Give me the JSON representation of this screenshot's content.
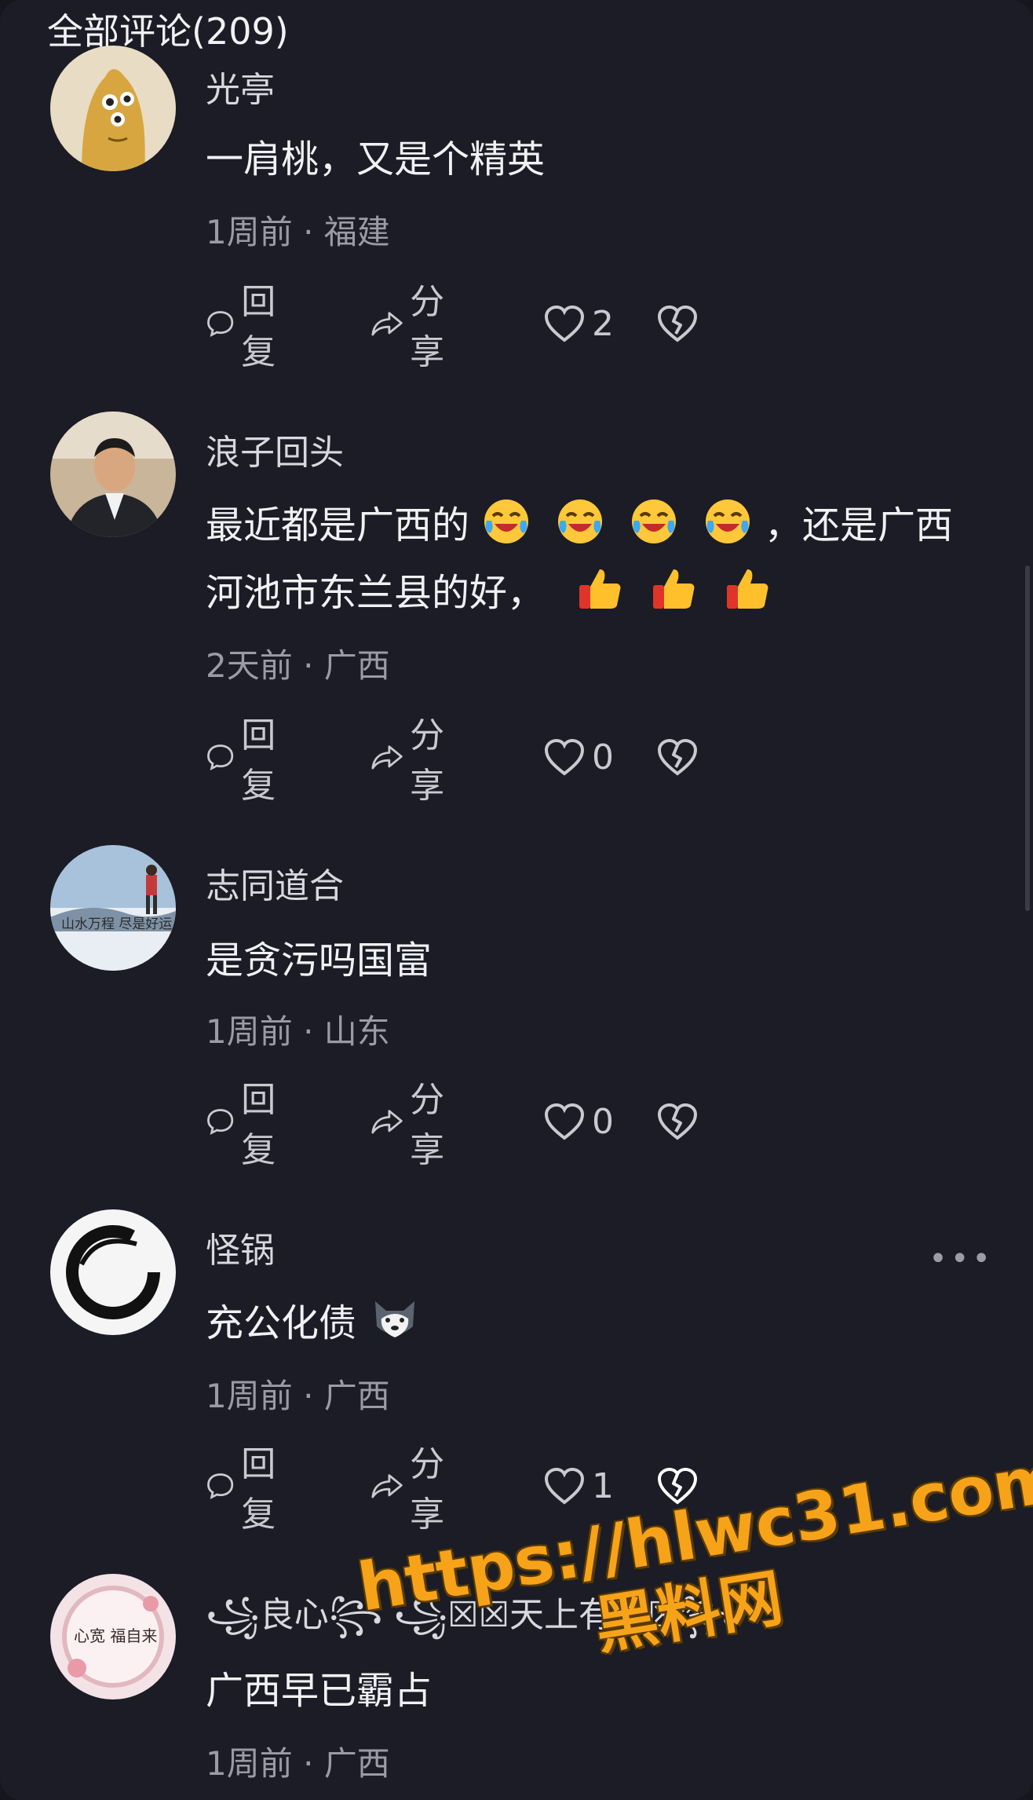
{
  "header": {
    "title": "全部评论(209)"
  },
  "comments": [
    {
      "username": "光亭",
      "content": "一肩桃，又是个精英",
      "meta": "1周前 · 福建",
      "reply_label": "回复",
      "share_label": "分享",
      "likes": "2"
    },
    {
      "username": "浪子回头",
      "content_line1_a": "最近都是广西的",
      "content_line1_b": "，还是广西",
      "content_line2": "河池市东兰县的好，",
      "meta": "2天前 · 广西",
      "reply_label": "回复",
      "share_label": "分享",
      "likes": "0"
    },
    {
      "username": "志同道合",
      "avatar_text": "山水万程 尽是好运",
      "content": "是贪污吗国富",
      "meta": "1周前 · 山东",
      "reply_label": "回复",
      "share_label": "分享",
      "likes": "0"
    },
    {
      "username": "怪锅",
      "content": "充公化债",
      "meta": "1周前 · 广西",
      "reply_label": "回复",
      "share_label": "分享",
      "likes": "1",
      "more": "•••"
    },
    {
      "username": "꧁良心꧂ ꧁☒☒天上有眼☒꧂",
      "avatar_text": "心宽 福自来",
      "content": "广西早已霸占",
      "meta": "1周前 · 广西"
    }
  ],
  "watermark": {
    "url": "https://hlwc31.com",
    "name": "黑料网"
  },
  "colors": {
    "background": "#1b1c25",
    "accent": "#f6a31a",
    "meta_text": "#9b9ba6"
  }
}
